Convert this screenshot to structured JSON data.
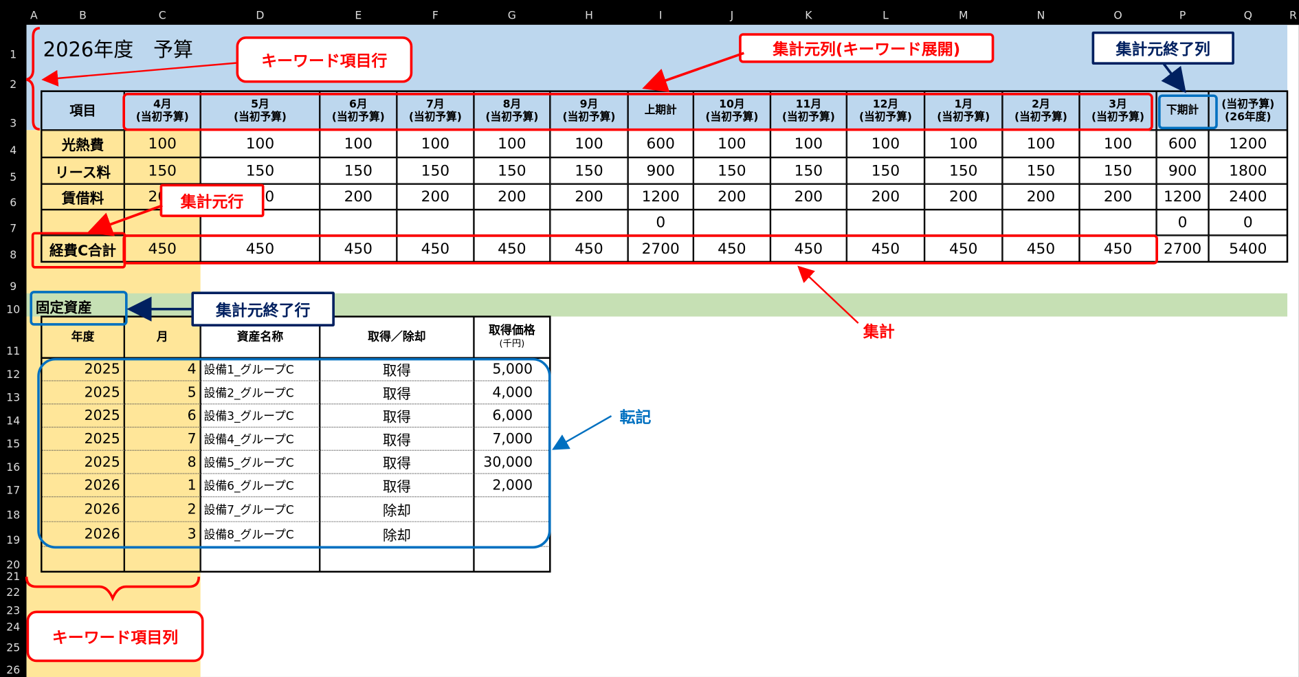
{
  "columns": [
    "A",
    "B",
    "C",
    "D",
    "E",
    "F",
    "G",
    "H",
    "I",
    "J",
    "K",
    "L",
    "M",
    "N",
    "O",
    "P",
    "Q",
    "R"
  ],
  "rows": [
    "1",
    "2",
    "3",
    "4",
    "5",
    "6",
    "7",
    "8",
    "9",
    "10",
    "11",
    "12",
    "13",
    "14",
    "15",
    "16",
    "17",
    "18",
    "19",
    "20",
    "21",
    "22",
    "23",
    "24",
    "25",
    "26"
  ],
  "title": "2026年度　予算",
  "budget": {
    "header_item": "項目",
    "month_headers": [
      {
        "m": "4月",
        "s": "(当初予算)"
      },
      {
        "m": "5月",
        "s": "(当初予算)"
      },
      {
        "m": "6月",
        "s": "(当初予算)"
      },
      {
        "m": "7月",
        "s": "(当初予算)"
      },
      {
        "m": "8月",
        "s": "(当初予算)"
      },
      {
        "m": "9月",
        "s": "(当初予算)"
      },
      {
        "m": "上期計",
        "s": ""
      },
      {
        "m": "10月",
        "s": "(当初予算)"
      },
      {
        "m": "11月",
        "s": "(当初予算)"
      },
      {
        "m": "12月",
        "s": "(当初予算)"
      },
      {
        "m": "1月",
        "s": "(当初予算)"
      },
      {
        "m": "2月",
        "s": "(当初予算)"
      },
      {
        "m": "3月",
        "s": "(当初予算)"
      },
      {
        "m": "下期計",
        "s": ""
      },
      {
        "m": "(当初予算)",
        "s": "(26年度)"
      }
    ],
    "rows": [
      {
        "label": "光熱費",
        "values": [
          "100",
          "100",
          "100",
          "100",
          "100",
          "100",
          "600",
          "100",
          "100",
          "100",
          "100",
          "100",
          "100",
          "600",
          "1200"
        ]
      },
      {
        "label": "リース料",
        "values": [
          "150",
          "150",
          "150",
          "150",
          "150",
          "150",
          "900",
          "150",
          "150",
          "150",
          "150",
          "150",
          "150",
          "900",
          "1800"
        ]
      },
      {
        "label": "賃借料",
        "values": [
          "200",
          "200",
          "200",
          "200",
          "200",
          "200",
          "1200",
          "200",
          "200",
          "200",
          "200",
          "200",
          "200",
          "1200",
          "2400"
        ]
      },
      {
        "label": "",
        "values": [
          "",
          "",
          "",
          "",
          "",
          "",
          "0",
          "",
          "",
          "",
          "",
          "",
          "",
          "0",
          "0"
        ]
      },
      {
        "label": "経費C合計",
        "values": [
          "450",
          "450",
          "450",
          "450",
          "450",
          "450",
          "2700",
          "450",
          "450",
          "450",
          "450",
          "450",
          "450",
          "2700",
          "5400"
        ]
      }
    ]
  },
  "assets": {
    "section_title": "固定資産",
    "headers": [
      "年度",
      "月",
      "資産名称",
      "取得／除却",
      "取得価格"
    ],
    "price_unit": "(千円)",
    "rows": [
      {
        "year": "2025",
        "month": "4",
        "name": "設備1_グループC",
        "type": "取得",
        "price": "5,000"
      },
      {
        "year": "2025",
        "month": "5",
        "name": "設備2_グループC",
        "type": "取得",
        "price": "4,000"
      },
      {
        "year": "2025",
        "month": "6",
        "name": "設備3_グループC",
        "type": "取得",
        "price": "6,000"
      },
      {
        "year": "2025",
        "month": "7",
        "name": "設備4_グループC",
        "type": "取得",
        "price": "7,000"
      },
      {
        "year": "2025",
        "month": "8",
        "name": "設備5_グループC",
        "type": "取得",
        "price": "30,000"
      },
      {
        "year": "2026",
        "month": "1",
        "name": "設備6_グループC",
        "type": "取得",
        "price": "2,000"
      },
      {
        "year": "2026",
        "month": "2",
        "name": "設備7_グループC",
        "type": "除却",
        "price": ""
      },
      {
        "year": "2026",
        "month": "3",
        "name": "設備8_グループC",
        "type": "除却",
        "price": ""
      },
      {
        "year": "",
        "month": "",
        "name": "",
        "type": "",
        "price": ""
      }
    ]
  },
  "annotations": {
    "keyword_row": "キーワード項目行",
    "source_cols": "集計元列(キーワード展開)",
    "source_end_col": "集計元終了列",
    "source_row": "集計元行",
    "aggregate": "集計",
    "source_end_row": "集計元終了行",
    "transfer": "転記",
    "keyword_col": "キーワード項目列"
  },
  "colors": {
    "header_blue": "#bdd7ee",
    "keyword_yellow": "#ffe699",
    "section_green": "#c6e0b4",
    "annotation_red": "#ff0000",
    "annotation_navy": "#002060",
    "annotation_blue": "#0070c0"
  }
}
